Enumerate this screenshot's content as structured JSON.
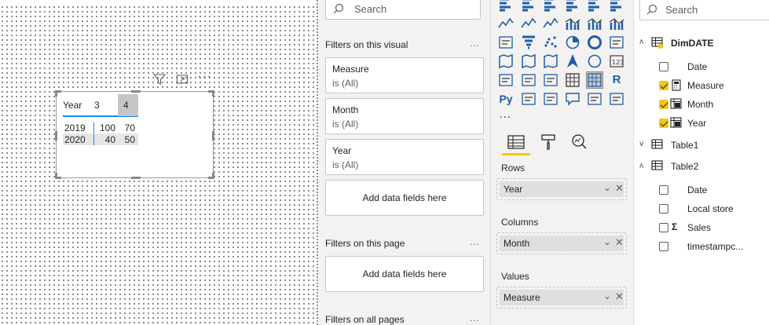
{
  "visual_table": {
    "header_row": "Year",
    "col_3": "3",
    "col_4": "4",
    "rows": [
      {
        "year": "2019",
        "v3": "100",
        "v4": "70"
      },
      {
        "year": "2020",
        "v3": "40",
        "v4": "50"
      }
    ]
  },
  "filters_pane": {
    "search_placeholder": "Search",
    "on_visual_title": "Filters on this visual",
    "cards": [
      {
        "field": "Measure",
        "state": "is (All)"
      },
      {
        "field": "Month",
        "state": "is (All)"
      },
      {
        "field": "Year",
        "state": "is (All)"
      }
    ],
    "add_data_fields": "Add data fields here",
    "on_page_title": "Filters on this page",
    "add_data_fields_page": "Add data fields here",
    "on_all_pages_title": "Filters on all pages",
    "more": "..."
  },
  "viz_pane": {
    "more_visuals": "...",
    "custom_r": "R",
    "custom_py": "Py",
    "wells": [
      {
        "title": "Rows",
        "field": "Year"
      },
      {
        "title": "Columns",
        "field": "Month"
      },
      {
        "title": "Values",
        "field": "Measure"
      }
    ]
  },
  "fields_pane": {
    "search_placeholder": "Search",
    "tables": [
      {
        "name": "DimDATE",
        "expanded": true,
        "fields": [
          {
            "name": "Date",
            "checked": false
          },
          {
            "name": "Measure",
            "checked": true
          },
          {
            "name": "Month",
            "checked": true
          },
          {
            "name": "Year",
            "checked": true
          }
        ]
      },
      {
        "name": "Table1",
        "expanded": false
      },
      {
        "name": "Table2",
        "expanded": true,
        "fields": [
          {
            "name": "Date",
            "checked": false
          },
          {
            "name": "Local store",
            "checked": false
          },
          {
            "name": "Sales",
            "checked": false
          },
          {
            "name": "timestampc...",
            "checked": false
          }
        ]
      }
    ]
  },
  "colors": {
    "accent_yellow": "#f2c811",
    "header_rule_blue": "#118dff",
    "pane_bg": "#f3f2f1"
  }
}
